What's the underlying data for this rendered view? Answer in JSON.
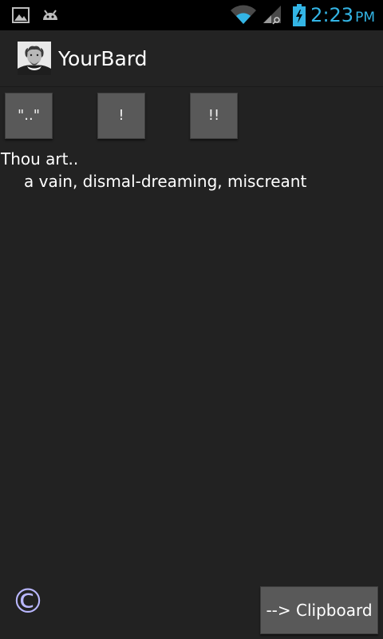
{
  "status_bar": {
    "time": "2:23",
    "ampm": "PM",
    "icons": [
      "gallery-notification-icon",
      "android-debug-icon",
      "wifi-icon",
      "signal-icon",
      "battery-charging-icon"
    ],
    "accent_color": "#33b5e5"
  },
  "action_bar": {
    "title": "YourBard",
    "logo_icon": "shakespeare-portrait-icon"
  },
  "controls": {
    "buttons": [
      {
        "label": "\"..\""
      },
      {
        "label": "!"
      },
      {
        "label": "!!"
      }
    ]
  },
  "main": {
    "prefix": "Thou art..",
    "insult": "a vain, dismal-dreaming, miscreant"
  },
  "footer": {
    "copyright_symbol": "©",
    "clipboard_label": "--> Clipboard"
  }
}
